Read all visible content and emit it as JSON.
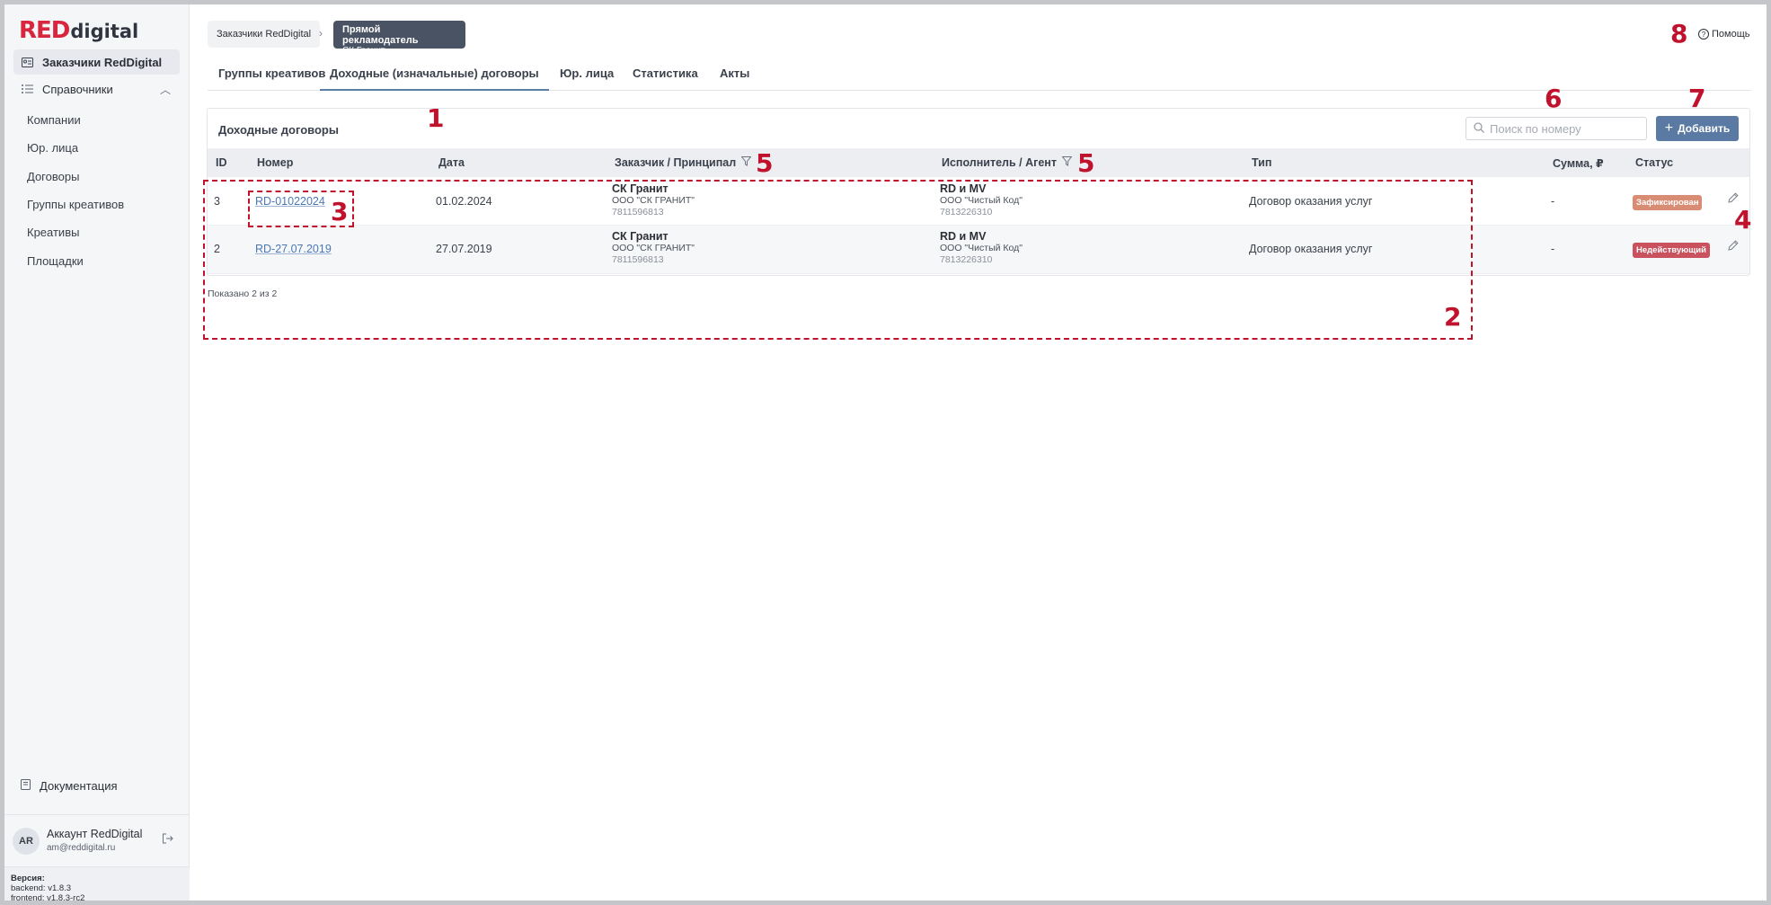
{
  "sidebar": {
    "logo": {
      "red": "RED",
      "rest": "digital"
    },
    "customers": "Заказчики RedDigital",
    "references": "Справочники",
    "sub_items": [
      "Компании",
      "Юр. лица",
      "Договоры",
      "Группы креативов",
      "Креативы",
      "Площадки"
    ],
    "docs": "Документация",
    "account": {
      "initials": "AR",
      "name": "Аккаунт RedDigital",
      "email": "am@reddigital.ru"
    },
    "version": {
      "label": "Версия:",
      "backend": "backend: v1.8.3",
      "frontend": "frontend: v1.8.3-rc2"
    }
  },
  "breadcrumb": {
    "first": "Заказчики RedDigital",
    "current_title": "Прямой рекламодатель",
    "current_sub": "СК Гранит"
  },
  "help": "Помощь",
  "tabs": [
    "Группы креативов",
    "Доходные (изначальные) договоры",
    "Юр. лица",
    "Статистика",
    "Акты"
  ],
  "active_tab": 1,
  "card": {
    "title": "Доходные договоры",
    "search_placeholder": "Поиск по номеру",
    "add_label": "Добавить",
    "columns": [
      "ID",
      "Номер",
      "Дата",
      "Заказчик / Принципал",
      "Исполнитель / Агент",
      "Тип",
      "Сумма, ₽",
      "Статус"
    ],
    "rows": [
      {
        "id": "3",
        "number": "RD-01022024",
        "date": "01.02.2024",
        "customer": {
          "name": "СК Гранит",
          "org": "ООО \"СК ГРАНИТ\"",
          "inn": "7811596813"
        },
        "agent": {
          "name": "RD и MV",
          "org": "ООО \"Чистый Код\"",
          "inn": "7813226310"
        },
        "type": "Договор оказания услуг",
        "sum": "-",
        "status": "Зафиксирован"
      },
      {
        "id": "2",
        "number": "RD-27.07.2019",
        "date": "27.07.2019",
        "customer": {
          "name": "СК Гранит",
          "org": "ООО \"СК ГРАНИТ\"",
          "inn": "7811596813"
        },
        "agent": {
          "name": "RD и MV",
          "org": "ООО \"Чистый Код\"",
          "inn": "7813226310"
        },
        "type": "Договор оказания услуг",
        "sum": "-",
        "status": "Недействующий"
      }
    ],
    "shown": "Показано 2 из 2"
  },
  "annotations": [
    "1",
    "2",
    "3",
    "4",
    "5",
    "5",
    "6",
    "7",
    "8"
  ],
  "colors": {
    "brand_red": "#d7263d",
    "accent": "#5a7aa3",
    "annotation": "#c0122d"
  }
}
